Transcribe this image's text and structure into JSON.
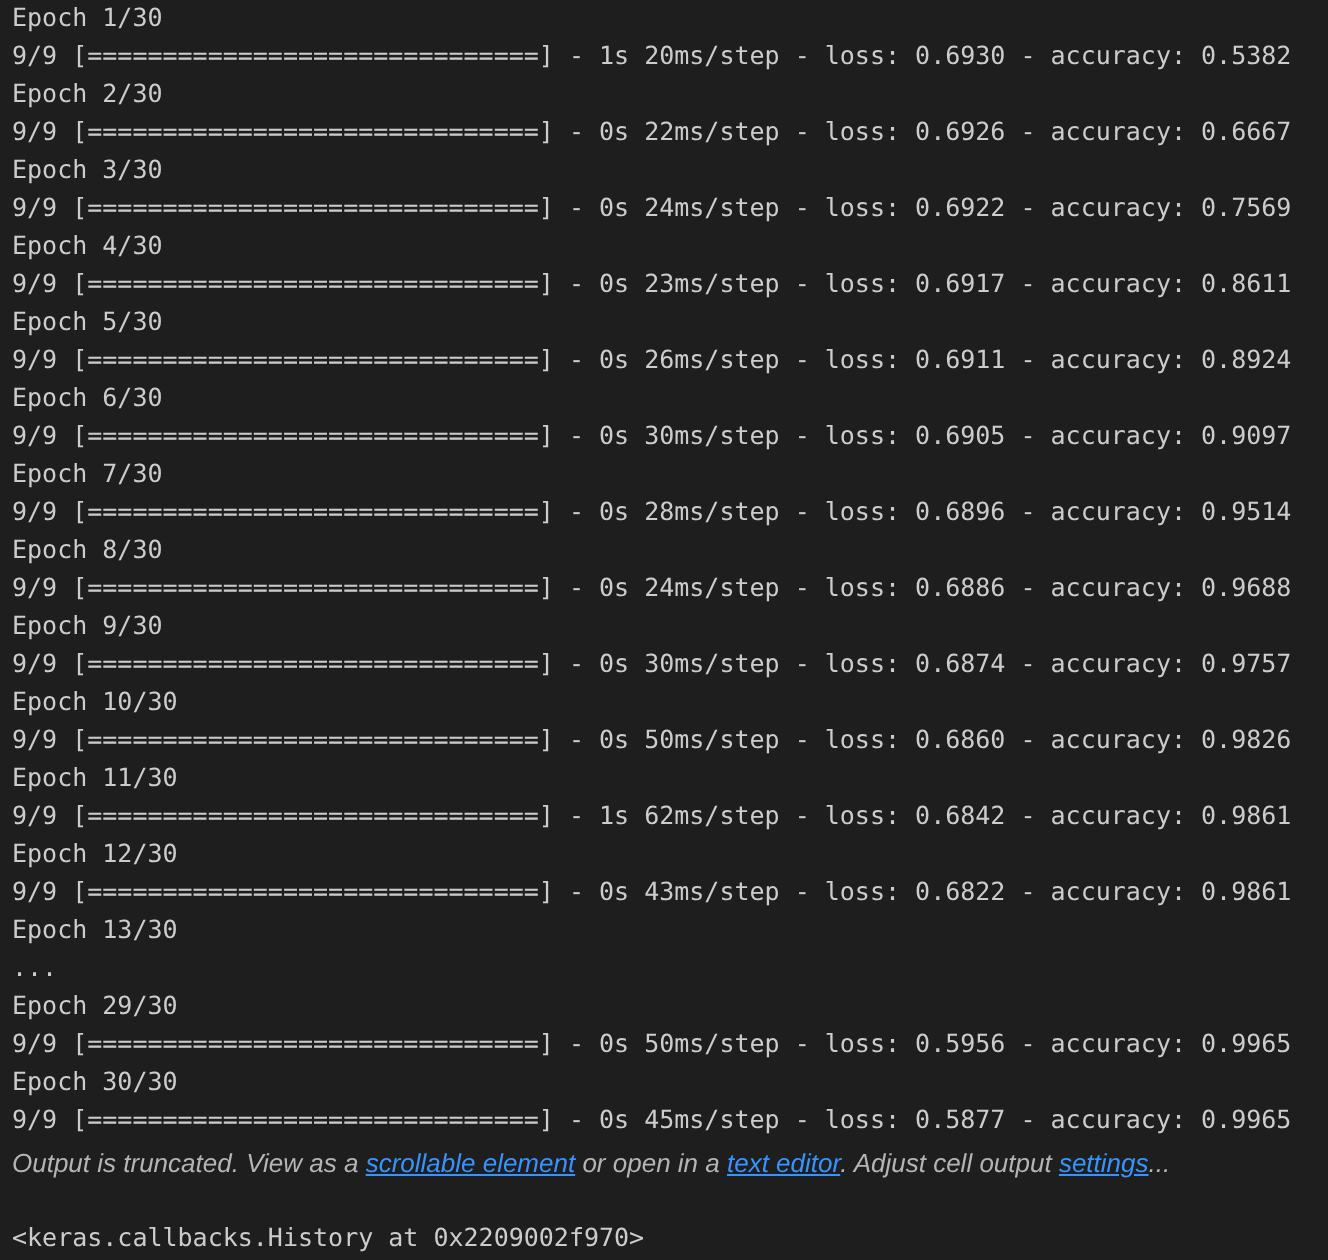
{
  "output": {
    "lines": [
      "Epoch 1/30",
      "9/9 [==============================] - 1s 20ms/step - loss: 0.6930 - accuracy: 0.5382",
      "Epoch 2/30",
      "9/9 [==============================] - 0s 22ms/step - loss: 0.6926 - accuracy: 0.6667",
      "Epoch 3/30",
      "9/9 [==============================] - 0s 24ms/step - loss: 0.6922 - accuracy: 0.7569",
      "Epoch 4/30",
      "9/9 [==============================] - 0s 23ms/step - loss: 0.6917 - accuracy: 0.8611",
      "Epoch 5/30",
      "9/9 [==============================] - 0s 26ms/step - loss: 0.6911 - accuracy: 0.8924",
      "Epoch 6/30",
      "9/9 [==============================] - 0s 30ms/step - loss: 0.6905 - accuracy: 0.9097",
      "Epoch 7/30",
      "9/9 [==============================] - 0s 28ms/step - loss: 0.6896 - accuracy: 0.9514",
      "Epoch 8/30",
      "9/9 [==============================] - 0s 24ms/step - loss: 0.6886 - accuracy: 0.9688",
      "Epoch 9/30",
      "9/9 [==============================] - 0s 30ms/step - loss: 0.6874 - accuracy: 0.9757",
      "Epoch 10/30",
      "9/9 [==============================] - 0s 50ms/step - loss: 0.6860 - accuracy: 0.9826",
      "Epoch 11/30",
      "9/9 [==============================] - 1s 62ms/step - loss: 0.6842 - accuracy: 0.9861",
      "Epoch 12/30",
      "9/9 [==============================] - 0s 43ms/step - loss: 0.6822 - accuracy: 0.9861",
      "Epoch 13/30",
      "...",
      "Epoch 29/30",
      "9/9 [==============================] - 0s 50ms/step - loss: 0.5956 - accuracy: 0.9965",
      "Epoch 30/30",
      "9/9 [==============================] - 0s 45ms/step - loss: 0.5877 - accuracy: 0.9965"
    ]
  },
  "truncation_notice": [
    {
      "kind": "plain",
      "text": "Output is truncated. View as a "
    },
    {
      "kind": "link",
      "text": "scrollable element"
    },
    {
      "kind": "plain",
      "text": " or open in a "
    },
    {
      "kind": "link",
      "text": "text editor"
    },
    {
      "kind": "plain",
      "text": ". Adjust cell output "
    },
    {
      "kind": "link",
      "text": "settings"
    },
    {
      "kind": "plain",
      "text": "..."
    }
  ],
  "result": "<keras.callbacks.History at 0x2209002f970>"
}
